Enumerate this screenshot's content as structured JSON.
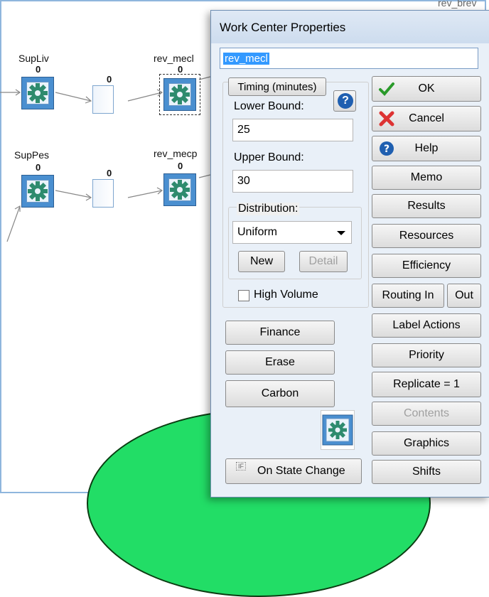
{
  "canvas": {
    "top_right_label": "rev_brev",
    "nodes": [
      {
        "label": "SupLiv",
        "count": "0"
      },
      {
        "label": "rev_mecl",
        "count": "0"
      },
      {
        "label": "SupPes",
        "count": "0"
      },
      {
        "label": "rev_mecp",
        "count": "0"
      }
    ],
    "buffers": [
      {
        "count": "0"
      },
      {
        "count": "0"
      }
    ]
  },
  "dialog": {
    "title": "Work Center Properties",
    "name_value": "rev_mecl",
    "timing_button": "Timing (minutes)",
    "lower_bound_label": "Lower Bound:",
    "lower_bound_value": "25",
    "upper_bound_label": "Upper Bound:",
    "upper_bound_value": "30",
    "distribution_label": "Distribution:",
    "distribution_value": "Uniform",
    "new_button": "New",
    "detail_button": "Detail",
    "high_volume_label": "High Volume",
    "finance_button": "Finance",
    "erase_button": "Erase",
    "carbon_button": "Carbon",
    "on_state_change_button": "On State Change",
    "state_change_icon_text": "IF",
    "right_buttons": {
      "ok": "OK",
      "cancel": "Cancel",
      "help": "Help",
      "memo": "Memo",
      "results": "Results",
      "resources": "Resources",
      "efficiency": "Efficiency",
      "routing_in": "Routing In",
      "out": "Out",
      "label_actions": "Label Actions",
      "priority": "Priority",
      "replicate": "Replicate = 1",
      "contents": "Contents",
      "graphics": "Graphics",
      "shifts": "Shifts"
    }
  },
  "colors": {
    "workcenter_fill": "#4a8fd0",
    "gear": "#2e8b6e",
    "blob": "#22dd66",
    "selection": "#3399ff"
  }
}
